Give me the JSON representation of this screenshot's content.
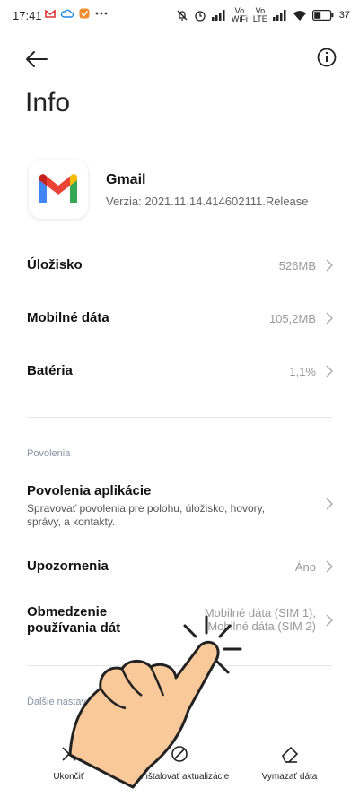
{
  "status_bar": {
    "time": "17:41",
    "volte_top": "Vo",
    "volte_bottom": "WiFi",
    "lte_top": "Vo",
    "lte_bottom": "LTE",
    "battery": "37"
  },
  "header": {
    "title": "Info"
  },
  "app": {
    "name": "Gmail",
    "version": "Verzia: 2021.11.14.414602111.Release"
  },
  "rows": [
    {
      "label": "Úložisko",
      "value": "526MB"
    },
    {
      "label": "Mobilné dáta",
      "value": "105,2MB"
    },
    {
      "label": "Batéria",
      "value": "1,1%"
    }
  ],
  "permissions": {
    "section_label": "Povolenia",
    "app_permissions": {
      "label": "Povolenia aplikácie",
      "subtitle": "Spravovať povolenia pre polohu, úložisko, hovory, správy, a kontakty."
    },
    "notifications": {
      "label": "Upozornenia",
      "value": "Áno"
    },
    "data_limit": {
      "label_line1": "Obmedzenie",
      "label_line2": "používania dát",
      "value_line1": "Mobilné dáta (SIM 1),",
      "value_line2": "Mobilné dáta (SIM 2)"
    }
  },
  "more_section_label": "Ďalšie nastavenia",
  "bottom_actions": [
    {
      "label": "Ukončiť",
      "icon": "close-icon"
    },
    {
      "label": "Odinštalovať aktualizácie",
      "icon": "block-icon"
    },
    {
      "label": "Vymazať dáta",
      "icon": "eraser-icon"
    }
  ],
  "overlay": {
    "icon": "pointing-hand-icon",
    "skin_color": "#f9c99a"
  }
}
